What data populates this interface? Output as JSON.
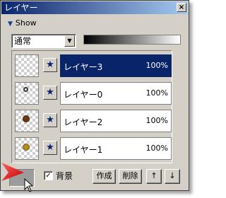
{
  "window": {
    "title": "レイヤー",
    "close_glyph": "×"
  },
  "show": {
    "label": "Show",
    "icon": "triangle-down-icon"
  },
  "blend_mode": {
    "value": "通常",
    "icon": "dropdown-arrow-icon"
  },
  "layers": [
    {
      "name": "レイヤー3",
      "opacity": "100%",
      "selected": true,
      "thumb": "empty"
    },
    {
      "name": "レイヤー0",
      "opacity": "100%",
      "selected": false,
      "thumb": "small-white-dot"
    },
    {
      "name": "レイヤー2",
      "opacity": "100%",
      "selected": false,
      "thumb": "brown-dot"
    },
    {
      "name": "レイヤー1",
      "opacity": "100%",
      "selected": false,
      "thumb": "gold-dot"
    }
  ],
  "background_checkbox": {
    "label": "背景",
    "checked": true
  },
  "buttons": {
    "create": "作成",
    "delete": "削除",
    "up": "↑",
    "down": "↓"
  },
  "colors": {
    "selection": "#0a246a",
    "panel": "#d4d0c8",
    "pointer": "#e02020"
  }
}
